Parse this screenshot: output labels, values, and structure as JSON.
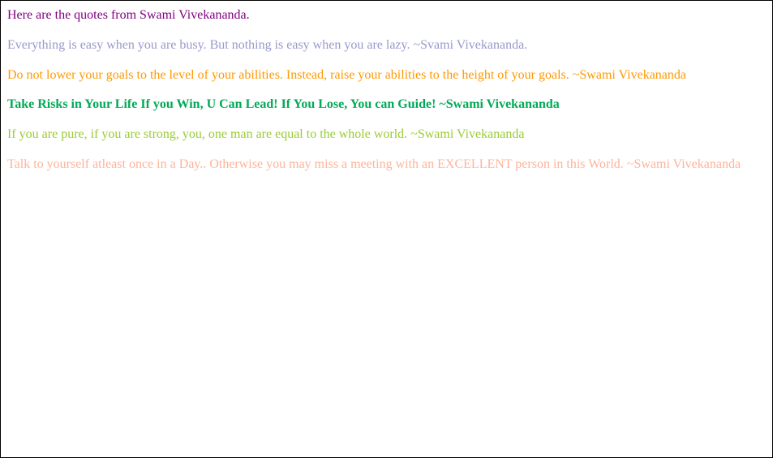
{
  "heading": "Here are the quotes from Swami Vivekananda.",
  "quotes": [
    "Everything is easy when you are busy. But nothing is easy when you are lazy. ~Svami Vivekananda.",
    "Do not lower your goals to the level of your abilities. Instead, raise your abilities to the height of your goals. ~Swami Vivekananda",
    "Take Risks in Your Life If you Win, U Can Lead! If You Lose, You can Guide! ~Swami Vivekananda",
    "If you are pure, if you are strong, you, one man are equal to the whole world. ~Swami Vivekananda",
    "Talk to yourself atleast once in a Day.. Otherwise you may miss a meeting with an EXCELLENT person in this World. ~Swami Vivekananda"
  ]
}
